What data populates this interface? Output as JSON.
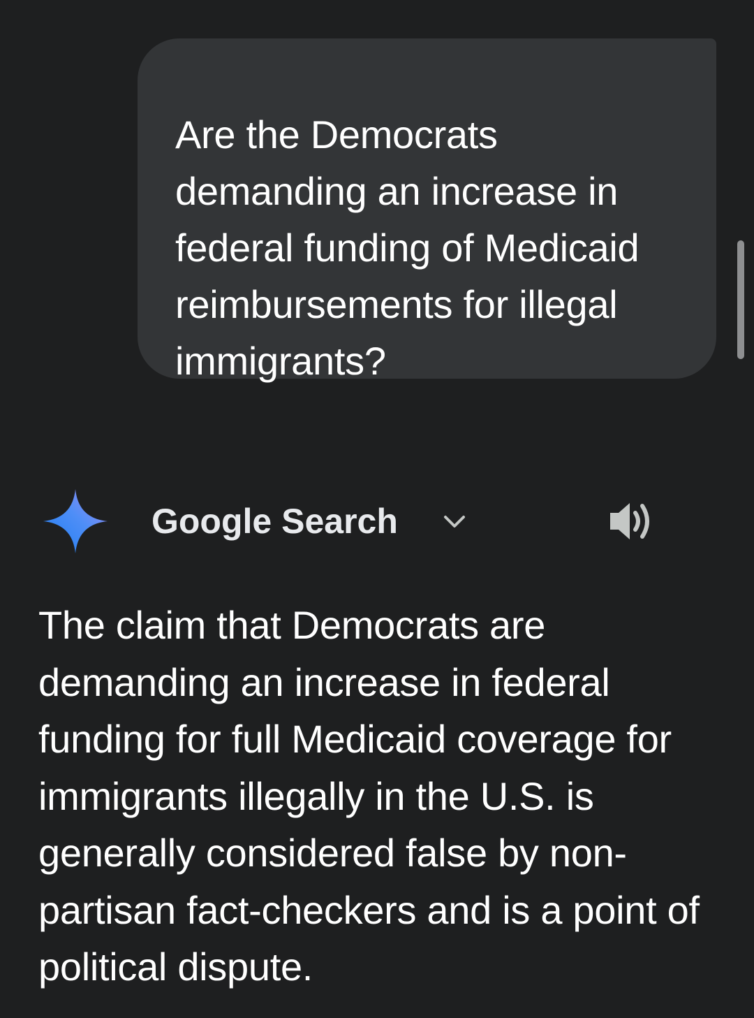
{
  "user_message": {
    "text": "Are the Democrats demanding an increase in federal funding of Medicaid reimbursements for illegal immigrants?"
  },
  "response": {
    "source_label": "Google Search",
    "text": "The claim that Democrats are demanding an increase in federal funding for full Medicaid coverage for immigrants illegally in the U.S. is generally considered false by non-partisan fact-checkers and is a point of political dispute."
  },
  "icons": {
    "assistant": "gemini-sparkle-icon",
    "expand": "chevron-down-icon",
    "read_aloud": "speaker-icon"
  },
  "colors": {
    "background": "#1e1f20",
    "user_bubble": "#333537",
    "text": "#ffffff",
    "icon_muted": "#c4c7c5"
  }
}
